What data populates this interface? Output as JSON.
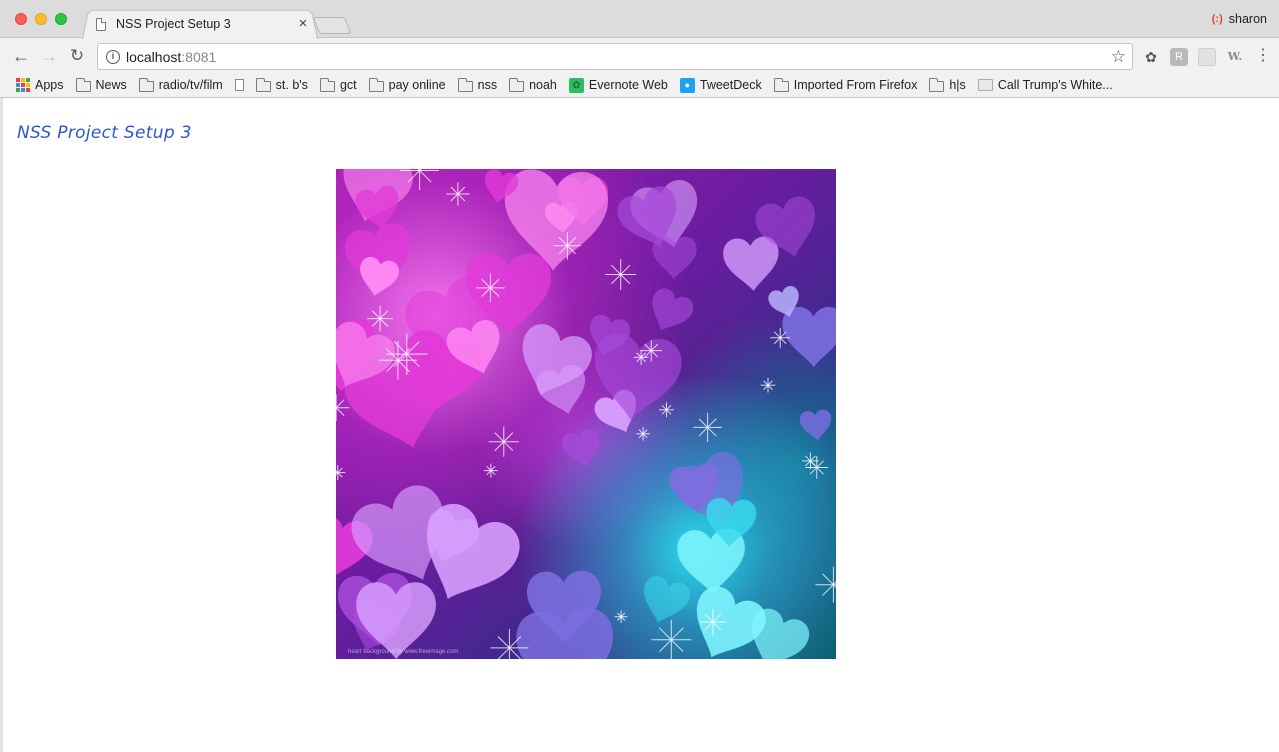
{
  "browser": {
    "tab_title": "NSS Project Setup 3",
    "tab_close": "×",
    "user_name": "sharon",
    "url_host": "localhost",
    "url_port": ":8081",
    "icons": {
      "back": "arrow-left",
      "forward": "arrow-right",
      "reload": "reload",
      "info": "info",
      "star": "star",
      "menu": "vertical-dots"
    }
  },
  "bookmarks": [
    {
      "label": "Apps",
      "icon": "apps-grid"
    },
    {
      "label": "News",
      "icon": "folder"
    },
    {
      "label": "radio/tv/film",
      "icon": "folder"
    },
    {
      "label": "",
      "icon": "page"
    },
    {
      "label": "st. b's",
      "icon": "folder"
    },
    {
      "label": "gct",
      "icon": "folder"
    },
    {
      "label": "pay online",
      "icon": "folder"
    },
    {
      "label": "nss",
      "icon": "folder"
    },
    {
      "label": "noah",
      "icon": "folder"
    },
    {
      "label": "Evernote Web",
      "icon": "evernote"
    },
    {
      "label": "TweetDeck",
      "icon": "tweetdeck"
    },
    {
      "label": "Imported From Firefox",
      "icon": "folder"
    },
    {
      "label": "h|s",
      "icon": "folder"
    },
    {
      "label": "Call Trump's White...",
      "icon": "whitehouse"
    }
  ],
  "page": {
    "heading": "NSS Project Setup 3",
    "image_caption": "heart background by www.freeimage.com",
    "colors": {
      "heading": "#2c57c9",
      "magenta": "#d020d0",
      "cyan": "#30e0f0"
    }
  }
}
